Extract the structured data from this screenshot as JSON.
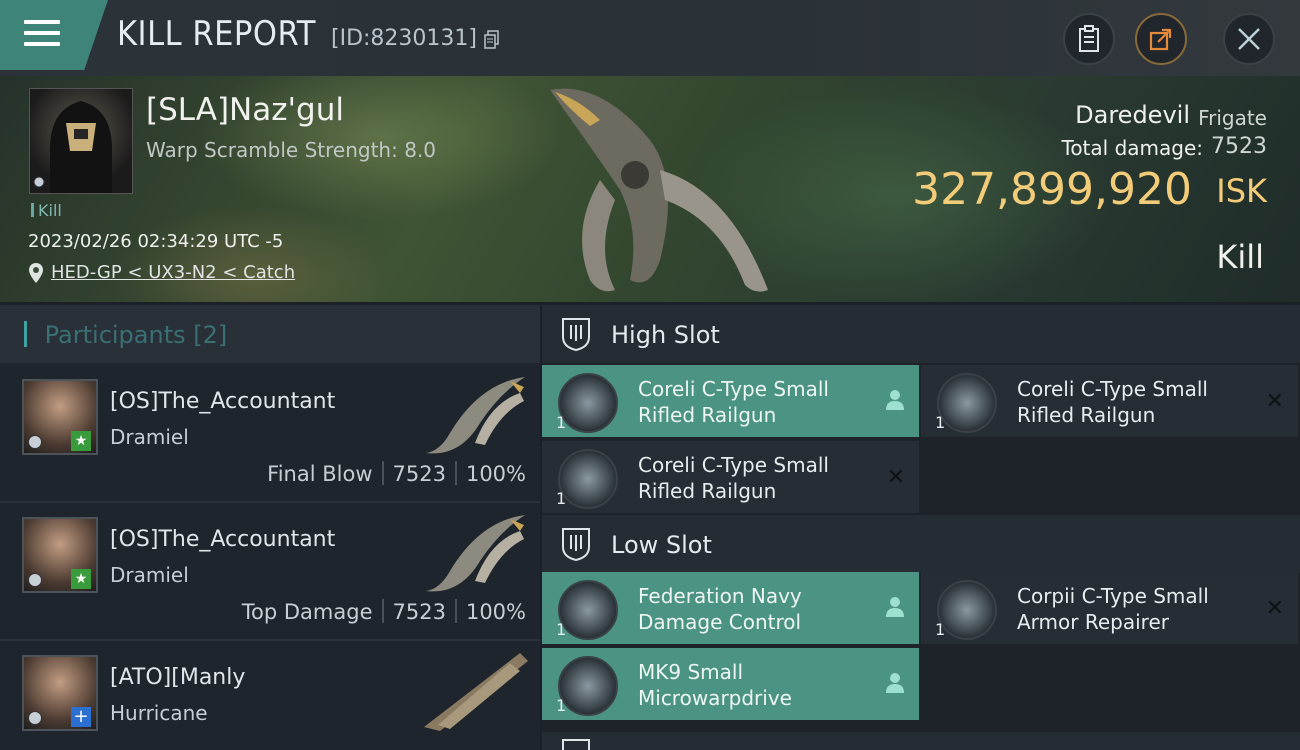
{
  "header": {
    "title": "KILL REPORT",
    "kill_id": "[ID:8230131]"
  },
  "victim": {
    "name": "[SLA]Naz'gul",
    "warp_scramble": "Warp Scramble Strength: 8.0",
    "tag": "Kill",
    "datetime": "2023/02/26 02:34:29 UTC -5",
    "location": "HED-GP < UX3-N2 < Catch",
    "ship_name": "Daredevil",
    "ship_class": "Frigate",
    "total_damage_label": "Total damage:",
    "total_damage": "7523",
    "isk_value": "327,899,920",
    "isk_unit": "ISK",
    "result": "Kill"
  },
  "participants": {
    "title": "Participants",
    "count": "[2]",
    "rows": [
      {
        "name": "[OS]The_Accountant",
        "ship": "Dramiel",
        "role": "Final Blow",
        "damage": "7523",
        "percent": "100%",
        "badge": "star"
      },
      {
        "name": "[OS]The_Accountant",
        "ship": "Dramiel",
        "role": "Top Damage",
        "damage": "7523",
        "percent": "100%",
        "badge": "star"
      },
      {
        "name": "[ATO][Manly",
        "ship": "Hurricane",
        "role": "",
        "damage": "",
        "percent": "",
        "badge": "plus"
      }
    ]
  },
  "slots": {
    "high": {
      "title": "High Slot",
      "modules": [
        {
          "line1": "Coreli C-Type Small",
          "line2": "Rifled Railgun",
          "qty": "1",
          "state": "fitted"
        },
        {
          "line1": "Coreli C-Type Small",
          "line2": "Rifled Railgun",
          "qty": "1",
          "state": "destroyed"
        },
        {
          "line1": "Coreli C-Type Small",
          "line2": "Rifled Railgun",
          "qty": "1",
          "state": "destroyed"
        }
      ]
    },
    "low": {
      "title": "Low Slot",
      "modules": [
        {
          "line1": "Federation Navy",
          "line2": "Damage Control",
          "qty": "1",
          "state": "fitted"
        },
        {
          "line1": "Corpii C-Type Small",
          "line2": "Armor Repairer",
          "qty": "1",
          "state": "destroyed"
        },
        {
          "line1": "MK9 Small",
          "line2": "Microwarpdrive",
          "qty": "1",
          "state": "fitted"
        }
      ]
    }
  },
  "colors": {
    "accent_teal": "#4b9483",
    "isk_gold": "#f3cc7a",
    "menu_tab": "#3f8478"
  },
  "icons": [
    "menu-icon",
    "copy-icon",
    "clipboard-icon",
    "share-icon",
    "close-icon",
    "location-pin-icon",
    "slot-shield-icon",
    "person-icon",
    "x-icon"
  ]
}
